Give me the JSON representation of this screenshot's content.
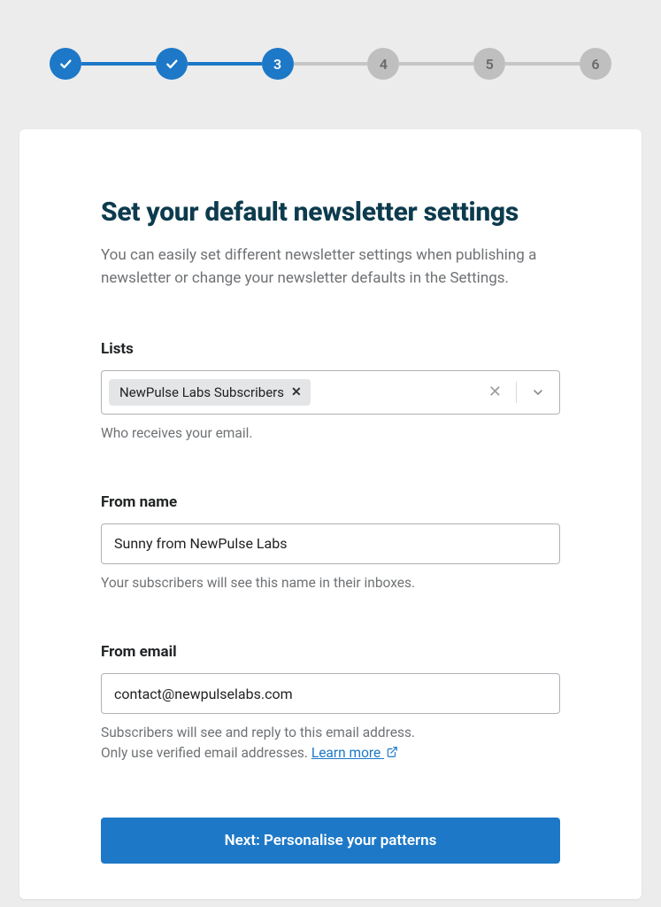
{
  "stepper": {
    "steps": [
      "",
      "",
      "3",
      "4",
      "5",
      "6"
    ],
    "currentIndex": 2
  },
  "page": {
    "title": "Set your default newsletter settings",
    "subtitle": "You can easily set different newsletter settings when publishing a newsletter or change your newsletter defaults in the Settings."
  },
  "lists": {
    "label": "Lists",
    "selected": "NewPulse Labs Subscribers",
    "helper": "Who receives your email."
  },
  "fromName": {
    "label": "From name",
    "value": "Sunny from NewPulse Labs",
    "helper": "Your subscribers will see this name in their inboxes."
  },
  "fromEmail": {
    "label": "From email",
    "value": "contact@newpulselabs.com",
    "helper1": "Subscribers will see and reply to this email address.",
    "helper2": "Only use verified email addresses. ",
    "learnMore": "Learn more"
  },
  "cta": "Next: Personalise your patterns"
}
